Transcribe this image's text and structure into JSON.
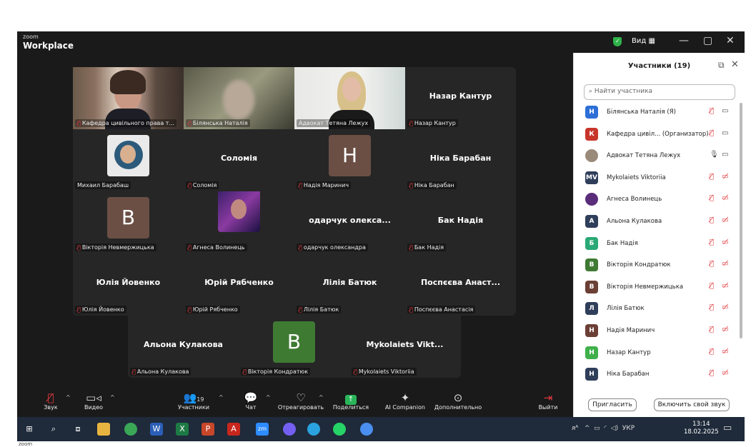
{
  "app": {
    "brand_top": "zoom",
    "brand": "Workplace",
    "view_label": "Вид ▦"
  },
  "grid_tiles": [
    {
      "label": "Кафедра цивільного права т...",
      "muted": true,
      "kind": "photo",
      "photo": "woman-bookshelf"
    },
    {
      "label": "Білянська Наталія",
      "muted": true,
      "kind": "photo",
      "photo": "woman-blurred"
    },
    {
      "label": "Адвокат Тетяна Лежух",
      "muted": false,
      "kind": "photo",
      "photo": "woman-blonde",
      "active": true
    },
    {
      "name": "Назар Кантур",
      "label": "Назар Кантур",
      "muted": true,
      "kind": "name"
    },
    {
      "label": "Михаил Барабаш",
      "muted": false,
      "kind": "avatar",
      "photo": "avatar-man"
    },
    {
      "name": "Соломія",
      "label": "Соломія",
      "muted": true,
      "kind": "name"
    },
    {
      "letter": "Н",
      "color": "#6b4f45",
      "label": "Надія Маринич",
      "muted": true,
      "kind": "letter"
    },
    {
      "name": "Ніка Барабан",
      "label": "Ніка Барабан",
      "muted": true,
      "kind": "name"
    },
    {
      "letter": "В",
      "color": "#6b4f45",
      "label": "Вікторія Невмержицька",
      "muted": true,
      "kind": "letter"
    },
    {
      "label": "Агнеса Волинець",
      "muted": true,
      "kind": "avatar",
      "photo": "avatar-girl"
    },
    {
      "name": "одарчук олекса...",
      "label": "одарчук олександра",
      "muted": true,
      "kind": "name"
    },
    {
      "name": "Бак Надія",
      "label": "Бак Надія",
      "muted": true,
      "kind": "name"
    },
    {
      "name": "Юлія Йовенко",
      "label": "Юлія Йовенко",
      "muted": true,
      "kind": "name"
    },
    {
      "name": "Юрій Рябченко",
      "label": "Юрій Рябченко",
      "muted": true,
      "kind": "name"
    },
    {
      "name": "Лілія Батюк",
      "label": "Лілія Батюк",
      "muted": true,
      "kind": "name"
    },
    {
      "name": "Поспєєва Анаст...",
      "label": "Поспєєва Анастасія",
      "muted": true,
      "kind": "name"
    }
  ],
  "bottom_tiles": [
    {
      "name": "Альона Кулакова",
      "label": "Альона Кулакова",
      "muted": true,
      "kind": "name"
    },
    {
      "letter": "В",
      "color": "#3f7a33",
      "label": "Вікторія Кондратюк",
      "muted": true,
      "kind": "letter"
    },
    {
      "name": "Mykolaiets Vikt...",
      "label": "Mykolaiets Viktoriia",
      "muted": true,
      "kind": "name"
    }
  ],
  "toolbar": {
    "audio": "Звук",
    "video": "Видео",
    "participants": "Участники",
    "participants_count": "19",
    "chat": "Чат",
    "react": "Отреагировать",
    "share": "Поделиться",
    "ai": "AI Companion",
    "more": "Дополнительно",
    "leave": "Выйти"
  },
  "panel": {
    "title": "Участники (19)",
    "search_placeholder": "Найти участника",
    "participants": [
      {
        "initials": "Н",
        "color": "#2d6fd6",
        "name": "Білянська Наталія (Я)",
        "mic": "off",
        "cam": "on"
      },
      {
        "initials": "К",
        "color": "#c7352b",
        "name": "Кафедра цивіл... (Организатор)",
        "mic": "off",
        "cam": "on"
      },
      {
        "initials": "",
        "color": "#9a8a7a",
        "name": "Адвокат Тетяна Лежух",
        "mic": "on",
        "cam": "on",
        "photo": true
      },
      {
        "initials": "MV",
        "color": "#2f3e5a",
        "name": "Mykolaiets Viktoriia",
        "mic": "off",
        "cam": "off"
      },
      {
        "initials": "",
        "color": "#5a2d7a",
        "name": "Агнеса Волинець",
        "mic": "off",
        "cam": "off",
        "photo": true
      },
      {
        "initials": "А",
        "color": "#2f3e5a",
        "name": "Альона Кулакова",
        "mic": "off",
        "cam": "off"
      },
      {
        "initials": "Б",
        "color": "#2aa876",
        "name": "Бак Надія",
        "mic": "off",
        "cam": "off"
      },
      {
        "initials": "В",
        "color": "#3f7a33",
        "name": "Вікторія Кондратюк",
        "mic": "off",
        "cam": "off"
      },
      {
        "initials": "В",
        "color": "#6b3f35",
        "name": "Вікторія Невмержицька",
        "mic": "off",
        "cam": "off"
      },
      {
        "initials": "Л",
        "color": "#2f3e5a",
        "name": "Лілія Батюк",
        "mic": "off",
        "cam": "off"
      },
      {
        "initials": "Н",
        "color": "#6b3f35",
        "name": "Надія Маринич",
        "mic": "off",
        "cam": "off"
      },
      {
        "initials": "Н",
        "color": "#3fb04a",
        "name": "Назар Кантур",
        "mic": "off",
        "cam": "off"
      },
      {
        "initials": "Н",
        "color": "#2f3e5a",
        "name": "Ніка Барабан",
        "mic": "off",
        "cam": "off"
      }
    ],
    "invite": "Пригласить",
    "unmute": "Включить свой звук"
  },
  "taskbar": {
    "lang": "УКР",
    "time": "13:14",
    "date": "18.02.2025"
  },
  "below": "zoom"
}
